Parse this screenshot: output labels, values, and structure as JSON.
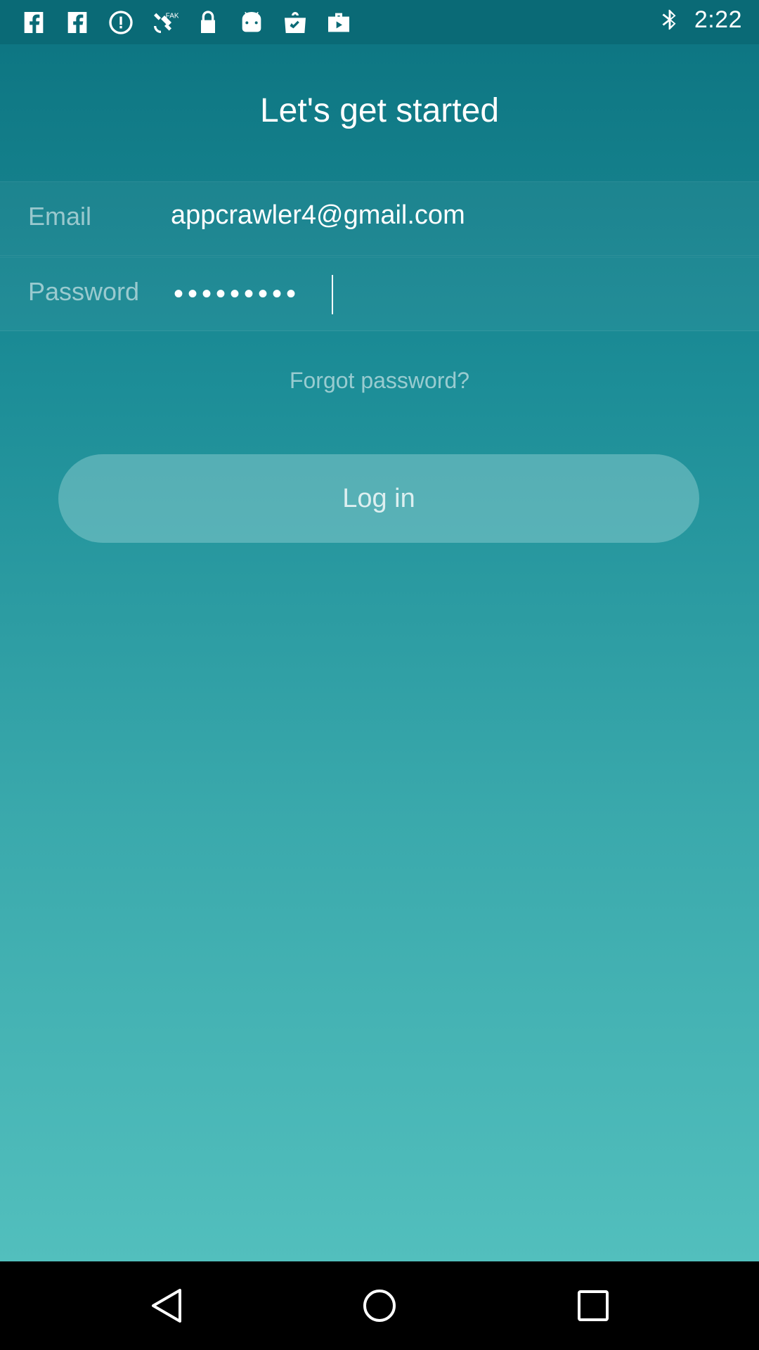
{
  "status_bar": {
    "time": "2:22",
    "icons": [
      "facebook-icon",
      "facebook-icon",
      "data-saver-icon",
      "fake-gps-satellite-icon",
      "lock-icon",
      "android-icon",
      "shopping-bag-check-icon",
      "briefcase-play-icon"
    ],
    "right_icons": [
      "bluetooth-icon",
      "wifi-icon",
      "signal-icon",
      "battery-icon"
    ]
  },
  "login": {
    "title": "Let's get started",
    "email_label": "Email",
    "email_value": "appcrawler4@gmail.com",
    "password_label": "Password",
    "password_value": "•••••••••",
    "forgot_password": "Forgot password?",
    "login_button": "Log in"
  },
  "nav_bar": {
    "buttons": [
      "back-icon",
      "home-icon",
      "recent-apps-icon"
    ]
  }
}
